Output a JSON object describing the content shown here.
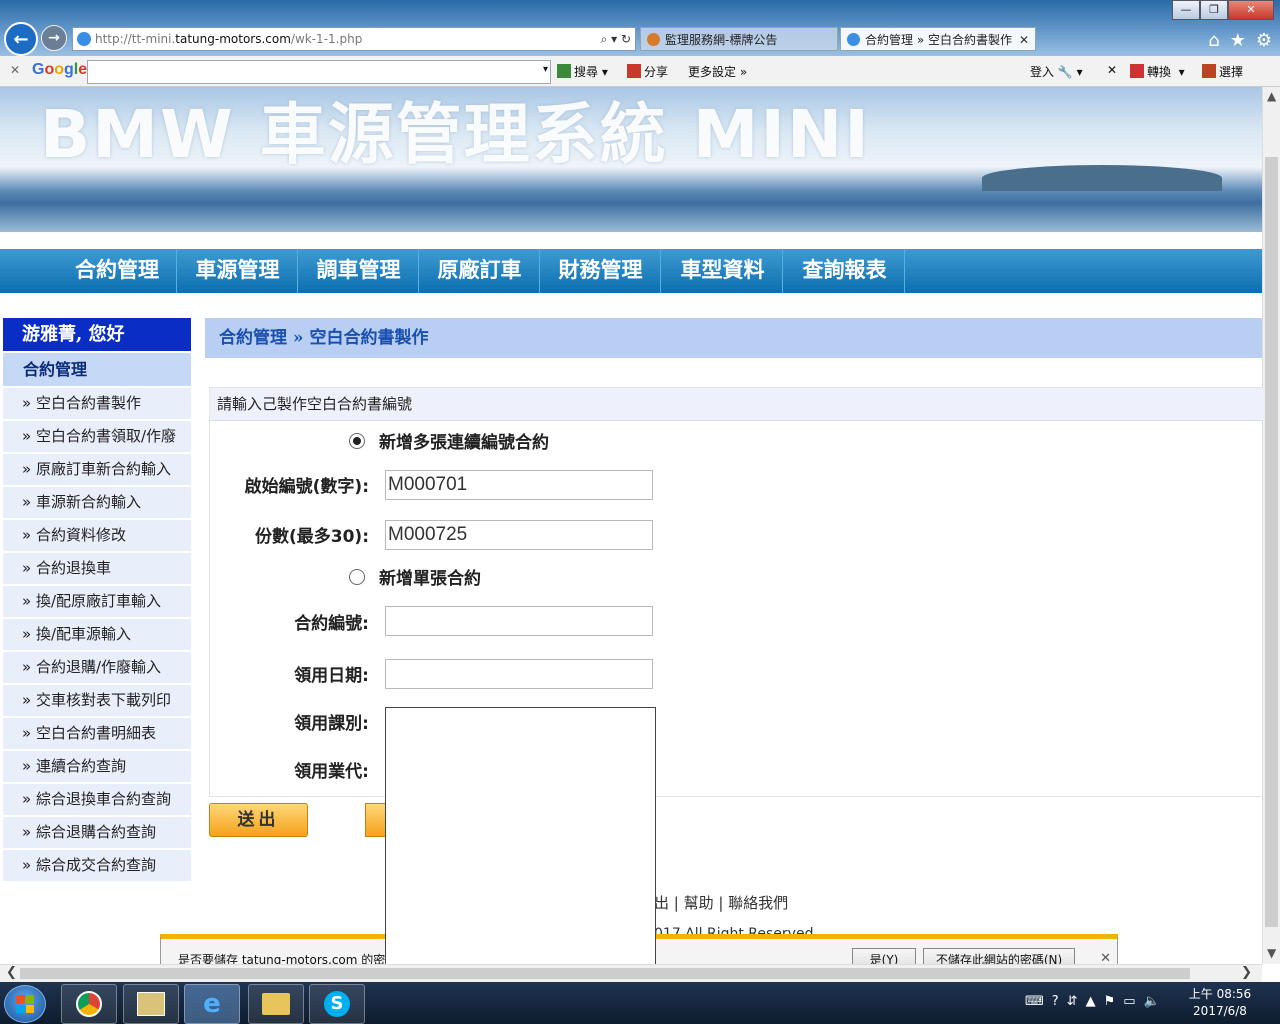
{
  "browser": {
    "url_prefix": "http://tt-mini.",
    "url_host": "tatung-motors.com",
    "url_path": "/wk-1-1.php",
    "tabs": [
      {
        "label": "監理服務網-標牌公告"
      },
      {
        "label": "合約管理 » 空白合約書製作"
      }
    ],
    "google_toolbar": {
      "logo": "Google",
      "search_label": "搜尋",
      "share_label": "分享",
      "more_label": "更多設定",
      "login_label": "登入",
      "translate_label": "轉換",
      "select_label": "選擇"
    }
  },
  "page": {
    "banner_title": "BMW 車源管理系統 MINI",
    "menu": [
      "合約管理",
      "車源管理",
      "調車管理",
      "原廠訂車",
      "財務管理",
      "車型資料",
      "查詢報表"
    ],
    "sidebar": {
      "greeting": "游雅菁, 您好",
      "section_title": "合約管理",
      "items": [
        "» 空白合約書製作",
        "» 空白合約書領取/作廢",
        "» 原廠訂車新合約輸入",
        "» 車源新合約輸入",
        "» 合約資料修改",
        "» 合約退換車",
        "» 換/配原廠訂車輸入",
        "» 換/配車源輸入",
        "» 合約退購/作廢輸入",
        "» 交車核對表下載列印",
        "» 空白合約書明細表",
        "» 連續合約查詢",
        "» 綜合退換車合約查詢",
        "» 綜合退購合約查詢",
        "» 綜合成交合約查詢"
      ]
    },
    "breadcrumb": "合約管理 » 空白合約書製作",
    "form": {
      "header": "請輸入己製作空白合約書編號",
      "option_multi": "新增多張連續編號合約",
      "option_single": "新增單張合約",
      "start_no_label": "啟始編號(數字):",
      "start_no_value": "M000701",
      "count_label": "份數(最多30):",
      "count_value": "M000725",
      "contract_no_label": "合約編號:",
      "issue_date_label": "領用日期:",
      "dept_label": "領用課別:",
      "agent_label": "領用業代:",
      "submit_label": "送出"
    },
    "footer": {
      "links": "出 | 幫助 | 聯絡我們",
      "copyright": "017 All Right Reserved"
    },
    "password_bar": {
      "message": "是否要儲存 tatung-motors.com 的密碼",
      "yes_label": "是(Y)",
      "no_label": "不儲存此網站的密碼(N)"
    }
  },
  "taskbar": {
    "time": "上午 08:56",
    "date": "2017/6/8"
  },
  "colors": {
    "menu_blue": "#0c6fb0",
    "greeting_bg": "#0a2ec5",
    "breadcrumb_bg": "#b8cff3",
    "button_orange": "#f4a21a",
    "pw_bar_accent": "#f0b400"
  }
}
